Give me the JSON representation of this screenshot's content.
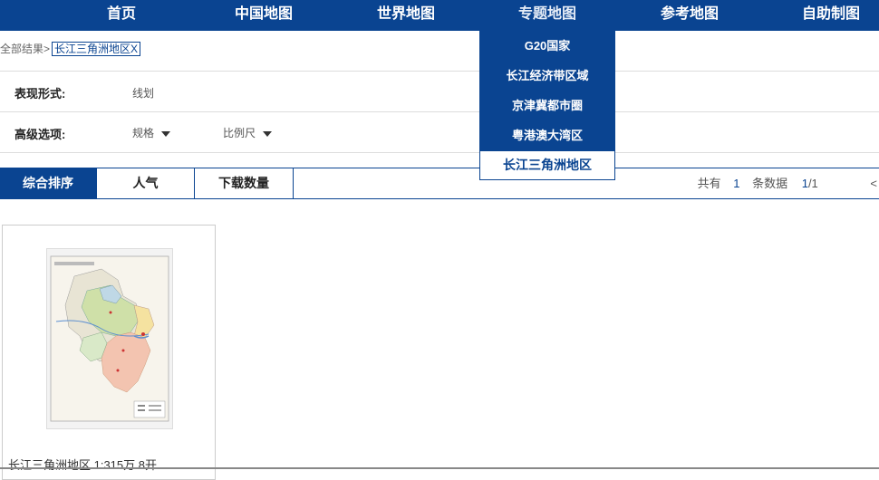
{
  "nav": {
    "items": [
      "首页",
      "中国地图",
      "世界地图",
      "专题地图",
      "参考地图",
      "自助制图"
    ],
    "active": "专题地图"
  },
  "dropdown": {
    "items": [
      "G20国家",
      "长江经济带区域",
      "京津冀都市圈",
      "粤港澳大湾区",
      "长江三角洲地区"
    ],
    "selected": "长江三角洲地区"
  },
  "breadcrumb": {
    "prefix": "全部结果>",
    "tag": "长江三角洲地区X"
  },
  "filters": {
    "form_label": "表现形式:",
    "form_value": "线划",
    "advanced_label": "高级选项:",
    "spec_label": "规格",
    "scale_label": "比例尺"
  },
  "sort": {
    "tabs": [
      "综合排序",
      "人气",
      "下载数量"
    ],
    "active": "综合排序"
  },
  "pager": {
    "total_prefix": "共有",
    "total": "1",
    "total_suffix": "条数据",
    "page_current": "1",
    "page_sep": "/1",
    "prev": "<"
  },
  "results": [
    {
      "title": "长江三角洲地区 1:315万 8开"
    }
  ],
  "colors": {
    "brand": "#0a4491"
  }
}
